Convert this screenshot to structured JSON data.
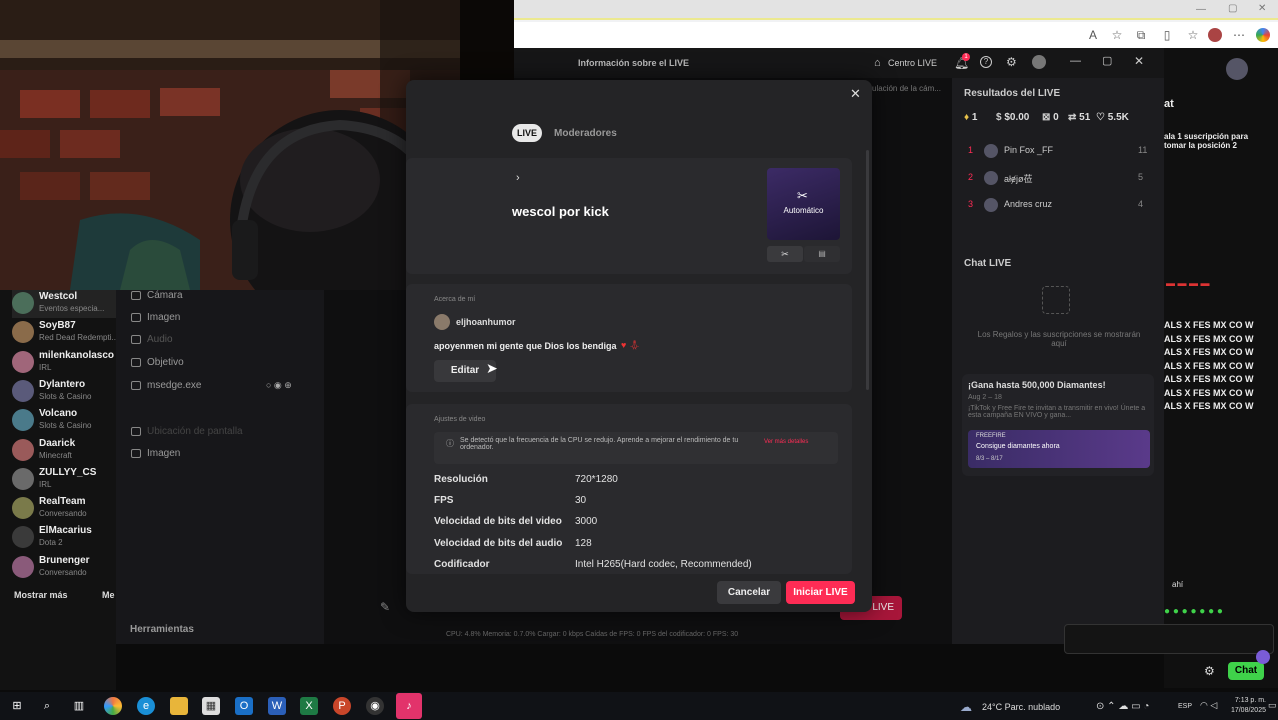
{
  "app": {
    "title": "Información sobre el LIVE",
    "centro_live": "Centro LIVE",
    "notif_count": "1"
  },
  "left_nav": {
    "channels": [
      {
        "name": "Westcol",
        "sub": "Eventos especia..."
      },
      {
        "name": "SoyB87",
        "sub": "Red Dead Redempti..."
      },
      {
        "name": "milenkanolasco",
        "sub": "IRL"
      },
      {
        "name": "Dylantero",
        "sub": "Slots & Casino"
      },
      {
        "name": "Volcano",
        "sub": "Slots & Casino"
      },
      {
        "name": "Daarick",
        "sub": "Minecraft"
      },
      {
        "name": "ZULLYY_CS",
        "sub": "IRL"
      },
      {
        "name": "RealTeam",
        "sub": "Conversando"
      },
      {
        "name": "ElMacarius",
        "sub": "Dota 2"
      },
      {
        "name": "Brunenger",
        "sub": "Conversando"
      }
    ],
    "show_more": "Mostrar más",
    "show_more_2": "Me"
  },
  "sources": {
    "items": [
      "Cámara",
      "Imagen",
      "Audio",
      "Objetivo",
      "msedge.exe",
      "",
      "Ubicación de pantalla",
      "Imagen"
    ],
    "tools_label": "Herramientas"
  },
  "center": {
    "hint": "ulación de la cám...",
    "stats": "CPU: 4.8%    Memoria: 0.7.0%    Cargar: 0 kbps    Caídas de FPS: 0    FPS del codificador: 0    FPS: 30",
    "go_live": "LIVE"
  },
  "right_panel": {
    "results_title": "Resultados del LIVE",
    "stats": [
      {
        "icon": "gem-icon",
        "value": "1"
      },
      {
        "icon": "dollar-icon",
        "value": "$0.00"
      },
      {
        "icon": "users-icon",
        "value": "0"
      },
      {
        "icon": "share-icon",
        "value": "51"
      },
      {
        "icon": "heart-icon",
        "value": "5.5K"
      }
    ],
    "leaders": [
      {
        "rank": "1",
        "name": "Pin Fox _FF",
        "score": "11"
      },
      {
        "rank": "2",
        "name": "ałɇjø莅",
        "score": "5"
      },
      {
        "rank": "3",
        "name": "Andres cruz",
        "score": "4"
      }
    ],
    "chat_title": "Chat LIVE",
    "chat_empty": "Los Regalos y las suscripciones se mostrarán aquí",
    "promo_title": "¡Gana hasta 500,000 Diamantes!",
    "promo_dates": "Aug 2 – 18",
    "promo_desc": "¡TikTok y Free Fire te invitan a transmitir en vivo! Únete a esta campaña EN VIVO y gana...",
    "promo_brand": "FREEFIRE",
    "promo_cta": "Consigue diamantes ahora",
    "promo_range": "8/3 – 8/17"
  },
  "external_chat": {
    "header": "at",
    "pinned": "ala 1 suscripción para\ntomar la posición 2",
    "lines": [
      "ALS X FES MX CO W",
      "ALS X FES MX CO W",
      "ALS X FES MX CO W",
      "ALS X FES MX CO W",
      "ALS X FES MX CO W",
      "ALS X FES MX CO W",
      "ALS X FES MX CO W"
    ],
    "tail": "ahí",
    "chat_button": "Chat"
  },
  "modal": {
    "tab_live": "LIVE",
    "tab_mods": "Moderadores",
    "stream_title": "wescol por kick",
    "thumb_label": "Automático",
    "about_title": "Acerca de mí",
    "username": "eljhoanhumor",
    "bio": "apoyenmen mi gente que Dios los bendiga",
    "edit_button": "Editar",
    "video_title": "Ajustes de video",
    "warning": "Se detectó que la frecuencia de la CPU se redujo. Aprende a mejorar el rendimiento de tu ordenador.",
    "warning_link": "Ver más detalles",
    "settings": [
      {
        "label": "Resolución",
        "value": "720*1280"
      },
      {
        "label": "FPS",
        "value": "30"
      },
      {
        "label": "Velocidad de bits del video",
        "value": "3000"
      },
      {
        "label": "Velocidad de bits del audio",
        "value": "128"
      },
      {
        "label": "Codificador",
        "value": "Intel H265(Hard codec, Recommended)"
      }
    ],
    "cancel": "Cancelar",
    "start": "Iniciar LIVE"
  },
  "taskbar": {
    "weather": "24°C  Parc. nublado",
    "lang": "ESP",
    "time": "7:13 p. m.",
    "date": "17/08/2025"
  },
  "colors": {
    "accent": "#fe2c55",
    "modal_bg": "#242426",
    "app_bg": "#1b1b1d",
    "chat_green": "#3fd24a"
  }
}
